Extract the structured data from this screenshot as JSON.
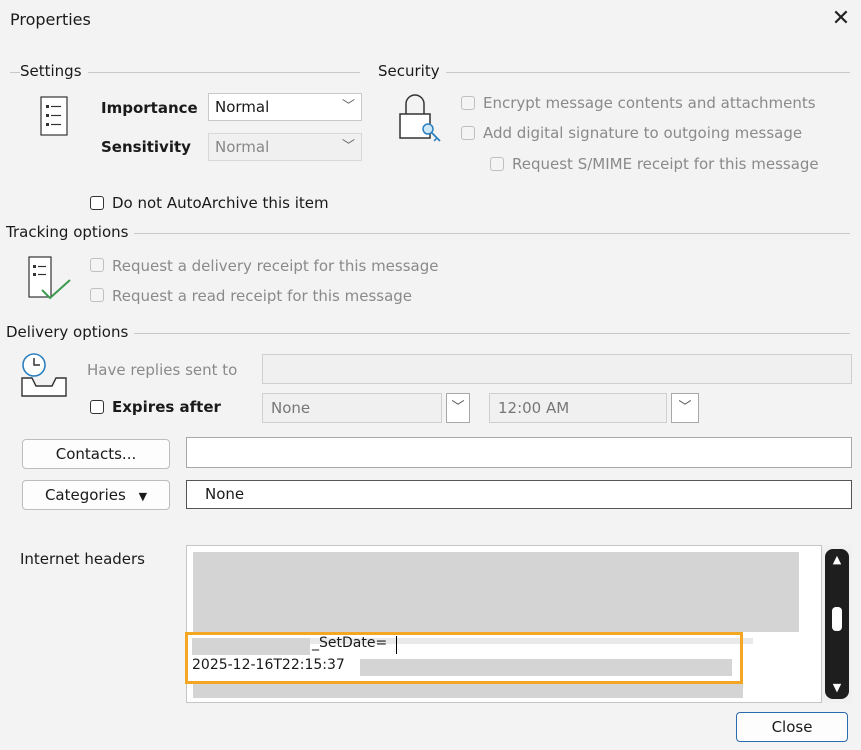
{
  "window": {
    "title": "Properties",
    "close_glyph": "✕"
  },
  "settings": {
    "label": "Settings",
    "importance_label": "Importance",
    "importance_value": "Normal",
    "sensitivity_label": "Sensitivity",
    "sensitivity_value": "Normal",
    "auto_archive_label": "Do not AutoArchive this item"
  },
  "security": {
    "label": "Security",
    "encrypt_label": "Encrypt message contents and attachments",
    "signature_label": "Add digital signature to outgoing message",
    "smime_label": "Request S/MIME receipt for this message"
  },
  "tracking": {
    "label": "Tracking options",
    "delivery_receipt_label": "Request a delivery receipt for this message",
    "read_receipt_label": "Request a read receipt for this message"
  },
  "delivery": {
    "label": "Delivery options",
    "replies_label": "Have replies sent to",
    "replies_value": "",
    "expires_label": "Expires after",
    "expires_date": "None",
    "expires_time": "12:00 AM"
  },
  "contacts": {
    "button_label": "Contacts...",
    "value": ""
  },
  "categories": {
    "button_label": "Categories",
    "value": "None"
  },
  "headers": {
    "label": "Internet headers",
    "line_1": "_SetDate=",
    "line_2": "2025-12-16T22:15:37"
  },
  "footer": {
    "close_label": "Close"
  }
}
